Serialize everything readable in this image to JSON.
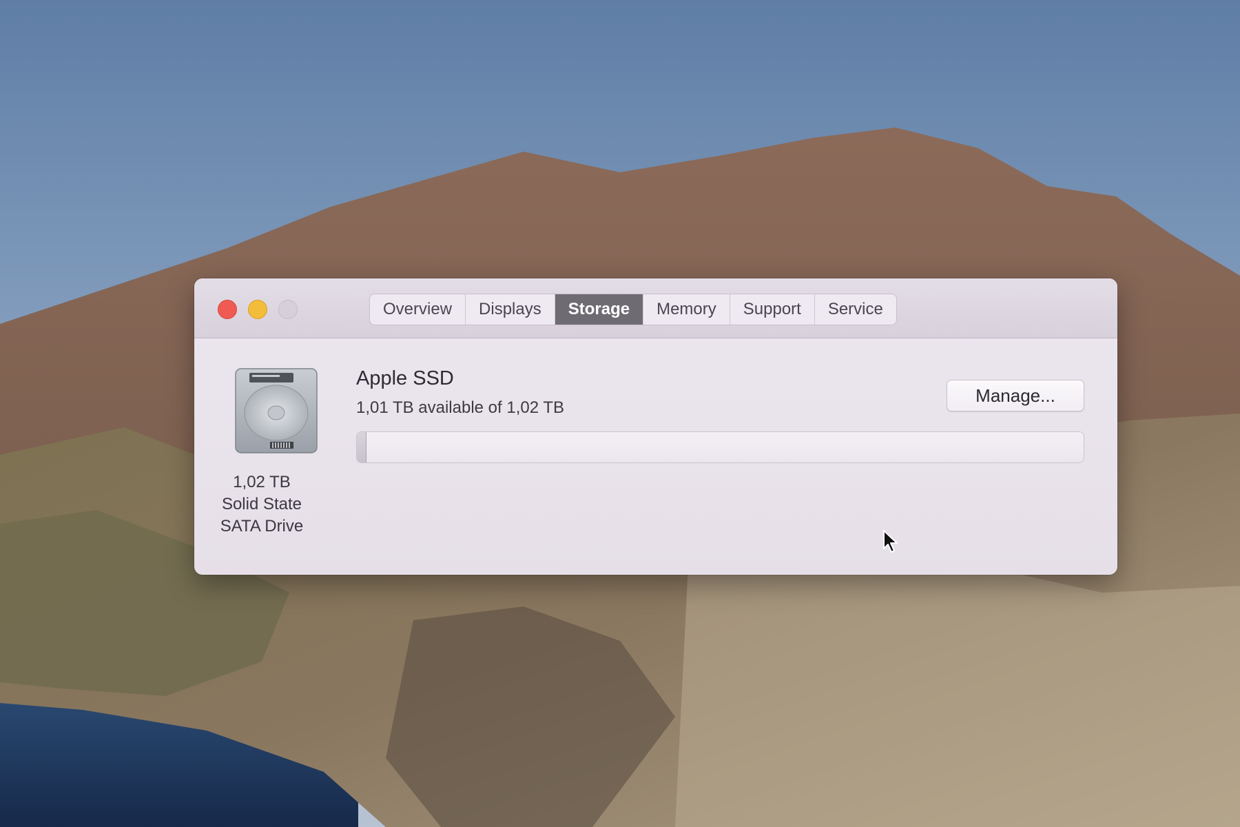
{
  "window": {
    "tabs": [
      {
        "label": "Overview",
        "active": false
      },
      {
        "label": "Displays",
        "active": false
      },
      {
        "label": "Storage",
        "active": true
      },
      {
        "label": "Memory",
        "active": false
      },
      {
        "label": "Support",
        "active": false
      },
      {
        "label": "Service",
        "active": false
      }
    ]
  },
  "storage": {
    "drive_name": "Apple SSD",
    "available_text": "1,01 TB available of 1,02 TB",
    "manage_label": "Manage...",
    "capacity_caption": [
      "1,02 TB",
      "Solid State",
      "SATA Drive"
    ],
    "used_fraction": 0.01
  },
  "icons": {
    "drive": "hard-drive-icon",
    "cursor": "mouse-pointer-icon"
  },
  "colors": {
    "close": "#ef5b52",
    "minimize": "#f3bd3b",
    "zoom_disabled": "#d6d0d9",
    "active_tab": "#6e6b73"
  }
}
